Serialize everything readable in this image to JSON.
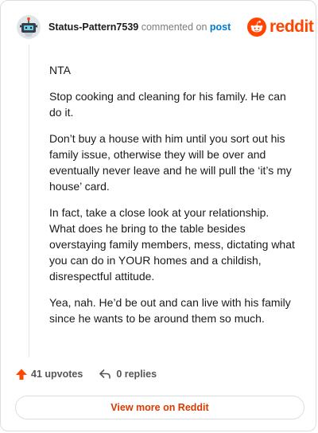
{
  "comment": {
    "username": "Status-Pattern7539",
    "action_text": "commented on",
    "post_link_text": "post",
    "paragraphs": [
      "NTA",
      "Stop cooking and cleaning for his family. He can do it.",
      "Don’t buy a house with him until you sort out his family issue, otherwise they will be over and eventually never leave and he will pull the ‘it’s my house’ card.",
      "In fact, take a close look at your relationship. What does he bring to the table besides overstaying family members, mess, dictating what you can do in YOUR homes and a childish, disrespectful attitude.",
      "Yea, nah. He’d be out and can live with his family since he wants to be around them so much."
    ]
  },
  "brand": {
    "name": "reddit",
    "color": "#ff4500"
  },
  "actions": {
    "upvotes": "41 upvotes",
    "replies": "0 replies"
  },
  "view_more_label": "View more on Reddit",
  "icons": {
    "avatar": "snoo-avatar-icon",
    "logo": "reddit-logo-icon",
    "upvote": "upvote-arrow-icon",
    "reply": "reply-arrow-icon"
  }
}
